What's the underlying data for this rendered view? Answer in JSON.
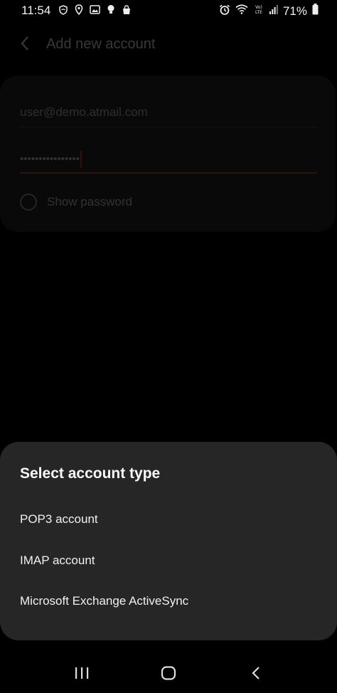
{
  "status_bar": {
    "time": "11:54",
    "battery": "71%",
    "left_icons": [
      "shield-wifi-icon",
      "location-icon",
      "image-icon",
      "bulb-icon",
      "bag-icon"
    ],
    "right_icons": [
      "alarm-icon",
      "wifi-icon",
      "volte-icon",
      "signal-icon",
      "battery-icon"
    ]
  },
  "background_screen": {
    "title": "Add new account",
    "email_value": "user@demo.atmail.com",
    "password_masked": "••••••••••••••••",
    "show_password_label": "Show password"
  },
  "sheet": {
    "title": "Select account type",
    "options": [
      "POP3 account",
      "IMAP account",
      "Microsoft Exchange ActiveSync"
    ]
  },
  "nav_bar": {
    "buttons": [
      "recents-icon",
      "home-icon",
      "back-icon"
    ]
  },
  "colors": {
    "accent": "#e0522b",
    "sheet_bg": "#262626",
    "background": "#000000"
  }
}
